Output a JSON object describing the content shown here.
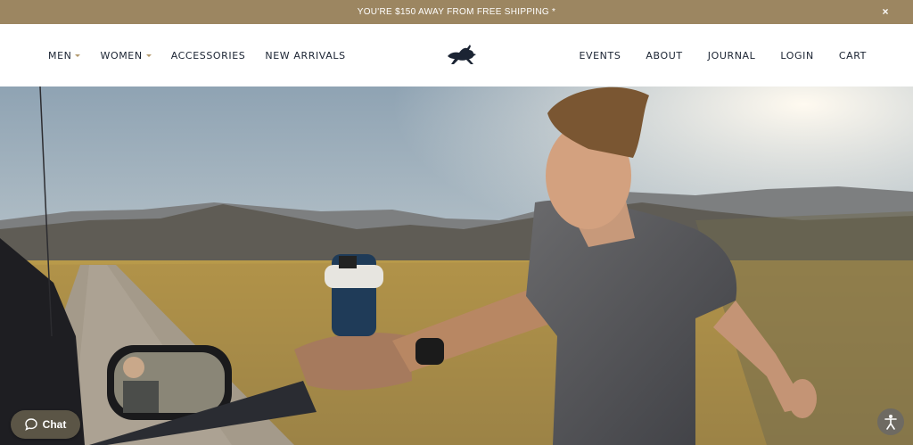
{
  "announcement": {
    "text": "YOU'RE $150 AWAY FROM FREE SHIPPING *",
    "close_glyph": "×"
  },
  "nav_left": [
    {
      "label": "MEN",
      "has_dropdown": true
    },
    {
      "label": "WOMEN",
      "has_dropdown": true
    },
    {
      "label": "ACCESSORIES",
      "has_dropdown": false
    },
    {
      "label": "NEW ARRIVALS",
      "has_dropdown": false
    }
  ],
  "nav_right": [
    {
      "label": "EVENTS"
    },
    {
      "label": "ABOUT"
    },
    {
      "label": "JOURNAL"
    },
    {
      "label": "LOGIN"
    },
    {
      "label": "CART"
    }
  ],
  "logo": {
    "icon": "running-rabbit-logo"
  },
  "hero": {
    "description_icon": "hero-photo"
  },
  "chat": {
    "label": "Chat",
    "icon": "chat-bubble-icon"
  },
  "accessibility": {
    "icon": "accessibility-icon"
  },
  "colors": {
    "banner": "#9c8661",
    "nav_text": "#1b2433",
    "caret": "#b39a6d",
    "chat_bg": "#5b5546"
  }
}
